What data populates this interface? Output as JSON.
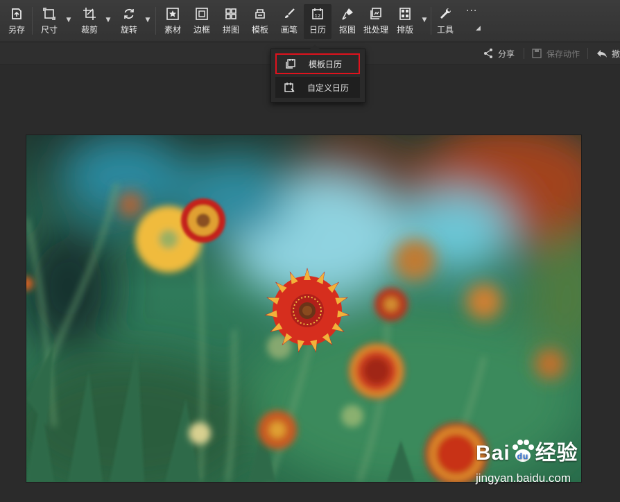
{
  "toolbar": {
    "items": [
      {
        "label": "另存",
        "icon": "save-as-icon"
      },
      {
        "label": "尺寸",
        "icon": "resize-icon"
      },
      {
        "label": "裁剪",
        "icon": "crop-icon"
      },
      {
        "label": "旋转",
        "icon": "rotate-icon"
      },
      {
        "label": "素材",
        "icon": "material-star-icon"
      },
      {
        "label": "边框",
        "icon": "frame-icon"
      },
      {
        "label": "拼图",
        "icon": "collage-icon"
      },
      {
        "label": "模板",
        "icon": "template-icon"
      },
      {
        "label": "画笔",
        "icon": "brush-icon"
      },
      {
        "label": "日历",
        "icon": "calendar-icon",
        "active": true
      },
      {
        "label": "抠图",
        "icon": "cutout-pen-icon"
      },
      {
        "label": "批处理",
        "icon": "batch-icon"
      },
      {
        "label": "排版",
        "icon": "layout-icon"
      },
      {
        "label": "工具",
        "icon": "wrench-icon"
      }
    ],
    "more_glyph": "···",
    "calendar_day": "12"
  },
  "subbar": {
    "share_label": "分享",
    "save_action_label": "保存动作",
    "undo_label": "撤"
  },
  "dropdown": {
    "items": [
      {
        "label": "模板日历",
        "icon": "template-calendar-icon",
        "highlighted": true
      },
      {
        "label": "自定义日历",
        "icon": "custom-calendar-icon"
      }
    ]
  },
  "watermark": {
    "brand_prefix": "Bai",
    "brand_suffix": "经验",
    "url": "jingyan.baidu.com"
  },
  "colors": {
    "highlight_box": "#e0121d",
    "toolbar_bg": "#3c3c3c",
    "page_bg": "#2b2b2b"
  }
}
